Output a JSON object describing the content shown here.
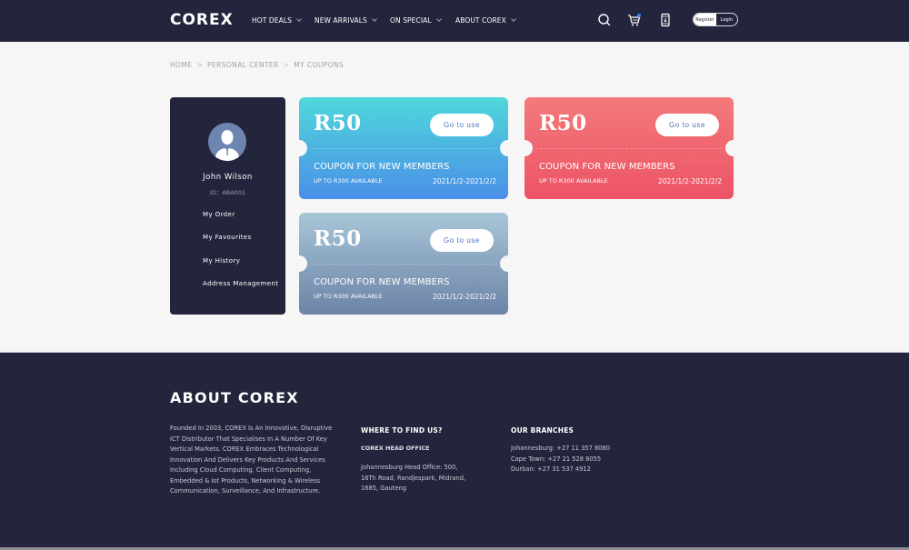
{
  "header": {
    "logo": "COREX",
    "nav": [
      {
        "label": "HOT DEALS"
      },
      {
        "label": "NEW ARRIVALS"
      },
      {
        "label": "ON SPECIAL"
      },
      {
        "label": "ABOUT COREX"
      }
    ],
    "icons": [
      "search-icon",
      "cart-icon",
      "mobile-icon"
    ],
    "cart_badge_color": "#3b82f6",
    "register_label": "Register",
    "login_label": "Login"
  },
  "breadcrumb": {
    "items": [
      "HOME",
      "PERSONAL CENTER",
      "MY COUPONS"
    ],
    "separator": ">"
  },
  "sidebar": {
    "user_name": "John Wilson",
    "user_id": "ID：ABA001",
    "menu": [
      {
        "label": "My Order"
      },
      {
        "label": "My Favourites"
      },
      {
        "label": "My History"
      },
      {
        "label": "Address Management"
      }
    ]
  },
  "coupons": [
    {
      "amount": "R50",
      "button": "Go to use",
      "title": "COUPON FOR NEW MEMBERS",
      "limit": "UP TO R300 AVAILABLE",
      "dates": "2021/1/2-2021/2/2",
      "theme": "blue"
    },
    {
      "amount": "R50",
      "button": "Go to use",
      "title": "COUPON FOR NEW MEMBERS",
      "limit": "UP TO R300 AVAILABLE",
      "dates": "2021/1/2-2021/2/2",
      "theme": "red"
    },
    {
      "amount": "R50",
      "button": "Go to use",
      "title": "COUPON FOR NEW MEMBERS",
      "limit": "UP TO R300 AVAILABLE",
      "dates": "2021/1/2-2021/2/2",
      "theme": "gray"
    }
  ],
  "footer": {
    "title": "ABOUT COREX",
    "about": "Founded In 2003, COREX Is An Innovative, Disruptive ICT Distributor That Specialises In A Number Of Key Vertical Markets. COREX Embraces Technological Innovation And Delivers Key Products And Services Including Cloud Computing, Client Computing, Embedded & Iot Products, Networking & Wireless Communication, Surveillance, And Infrastructure.",
    "find_us": {
      "heading": "WHERE TO FIND US?",
      "office": "COREX HEAD OFFICE",
      "address_lines": [
        "Johannesburg Head Office: 500,",
        "16Th Road, Randjespark, Midrand,",
        "1685, Gauteng"
      ]
    },
    "branches": {
      "heading": "OUR BRANCHES",
      "lines": [
        "Johannesburg: +27 11 357 8080",
        "Cape Town: +27 21 528 8055",
        "Durban: +27 31 537 4912"
      ]
    }
  }
}
